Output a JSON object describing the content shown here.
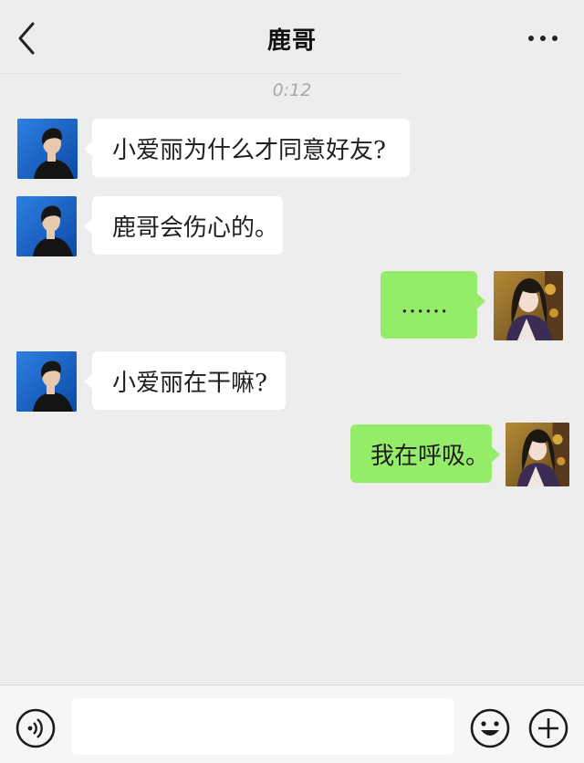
{
  "header": {
    "title": "鹿哥",
    "back_icon": "chevron-left-icon",
    "more_icon": "more-dots-icon"
  },
  "timestamp": "0:12",
  "messages": [
    {
      "side": "incoming",
      "text": "小爱丽为什么才同意好友?"
    },
    {
      "side": "incoming",
      "text": "鹿哥会伤心的。"
    },
    {
      "side": "outgoing",
      "text": "……"
    },
    {
      "side": "incoming",
      "text": "小爱丽在干嘛?"
    },
    {
      "side": "outgoing",
      "text": "我在呼吸。"
    }
  ],
  "input": {
    "value": "",
    "placeholder": ""
  },
  "footer": {
    "voice_icon": "voice-icon",
    "emoji_icon": "emoji-icon",
    "plus_icon": "plus-icon"
  },
  "colors": {
    "background": "#ededed",
    "incoming_bubble": "#ffffff",
    "outgoing_bubble": "#95ec69",
    "contact_avatar_bg": "#1a63c9"
  }
}
